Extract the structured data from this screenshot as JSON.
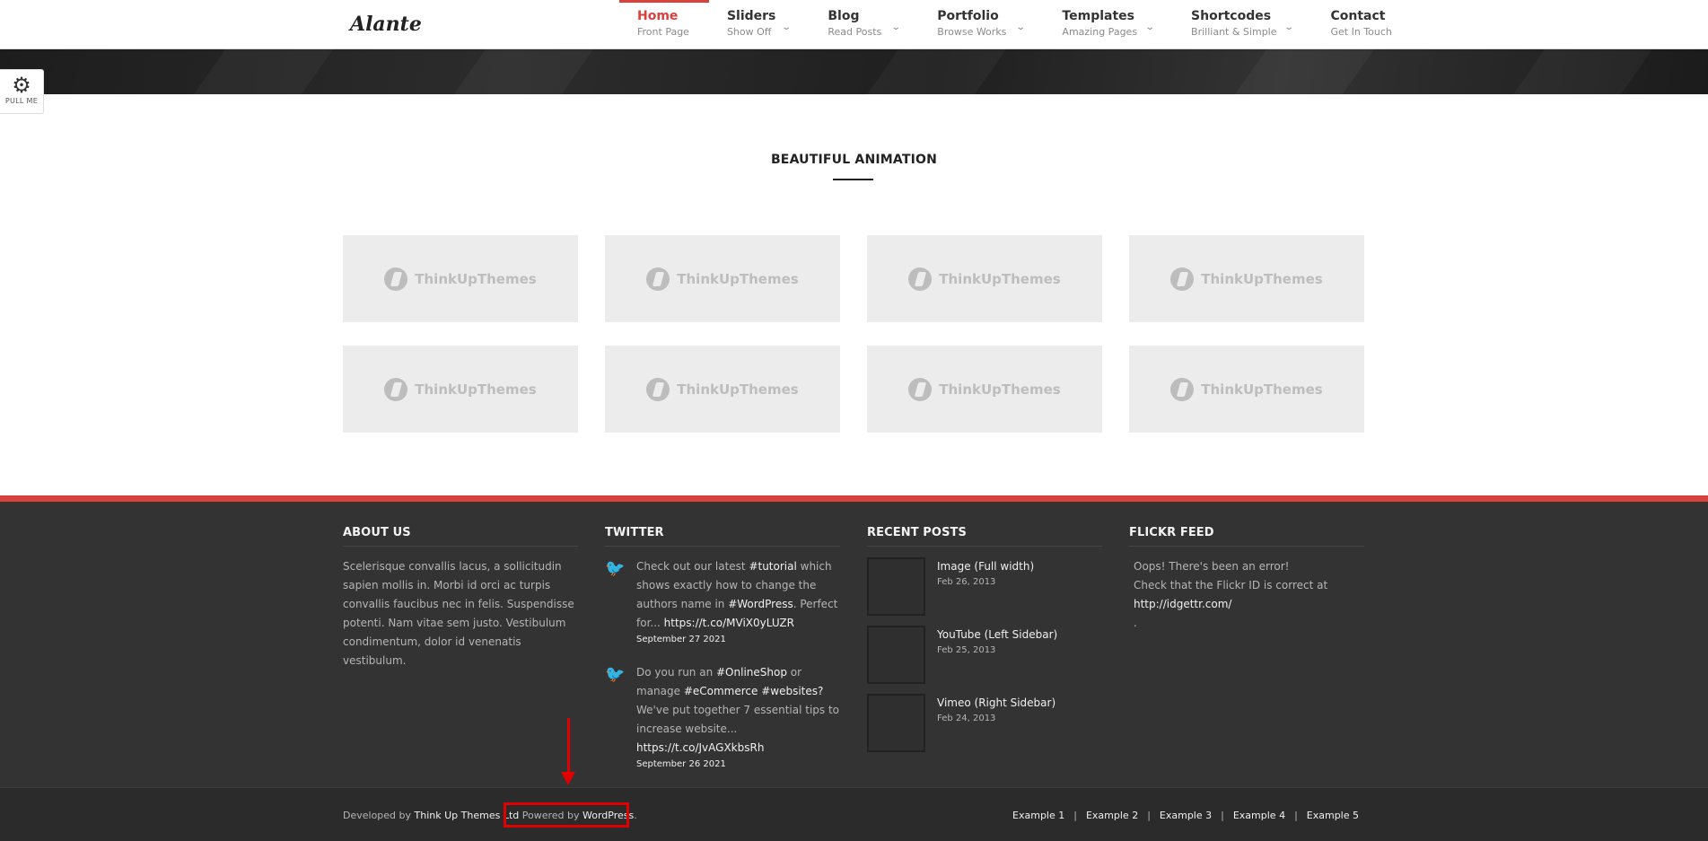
{
  "header": {
    "logo": "Alante",
    "nav": [
      {
        "title": "Home",
        "subtitle": "Front Page"
      },
      {
        "title": "Sliders",
        "subtitle": "Show Off"
      },
      {
        "title": "Blog",
        "subtitle": "Read Posts"
      },
      {
        "title": "Portfolio",
        "subtitle": "Browse Works"
      },
      {
        "title": "Templates",
        "subtitle": "Amazing Pages"
      },
      {
        "title": "Shortcodes",
        "subtitle": "Brilliant & Simple"
      },
      {
        "title": "Contact",
        "subtitle": "Get In Touch"
      }
    ]
  },
  "pull": {
    "label": "PULL ME",
    "icon": "gear-icon"
  },
  "section": {
    "title": "BEAUTIFUL ANIMATION"
  },
  "gallery": {
    "tile_label": "ThinkUpThemes",
    "count": 8
  },
  "footer": {
    "about": {
      "title": "ABOUT US",
      "text": "Scelerisque convallis lacus, a sollicitudin sapien mollis in. Morbi id orci ac turpis convallis faucibus nec in felis. Suspendisse potenti. Nam vitae sem justo. Vestibulum condimentum, dolor id venenatis vestibulum."
    },
    "twitter": {
      "title": "TWITTER",
      "tweets": [
        {
          "p1": "Check out our latest ",
          "h1": "#tutorial",
          "p2": " which shows exactly how to change the authors name in ",
          "h2": "#WordPress",
          "p3": ". Perfect for... ",
          "link": "https://t.co/MViX0yLUZR",
          "date": "September 27 2021"
        },
        {
          "p1": "Do you run an ",
          "h1": "#OnlineShop",
          "p2": " or manage ",
          "h2": "#eCommerce #websites?",
          "p3": " We've put together 7 essential tips to increase website... ",
          "link": "https://t.co/JvAGXkbsRh",
          "date": "September 26 2021"
        }
      ]
    },
    "recent_posts": {
      "title": "RECENT POSTS",
      "posts": [
        {
          "title": "Image (Full width)",
          "date": "Feb 26, 2013"
        },
        {
          "title": "YouTube (Left Sidebar)",
          "date": "Feb 25, 2013"
        },
        {
          "title": "Vimeo (Right Sidebar)",
          "date": "Feb 24, 2013"
        }
      ]
    },
    "flickr": {
      "title": "FLICKR FEED",
      "line1": "Oops! There's been an error!",
      "line2": "Check that the Flickr ID is correct at",
      "link": "http://idgettr.com/",
      "line3": "."
    }
  },
  "copyright": {
    "developed_by": "Developed by ",
    "company": "Think Up Themes Ltd",
    "powered_by": " Powered by ",
    "wordpress": "WordPress",
    "dot": ".",
    "links": [
      "Example 1",
      "Example 2",
      "Example 3",
      "Example 4",
      "Example 5"
    ]
  },
  "colors": {
    "accent": "#d9413d",
    "footer_bg": "#333333",
    "annotation": "#e00000"
  }
}
